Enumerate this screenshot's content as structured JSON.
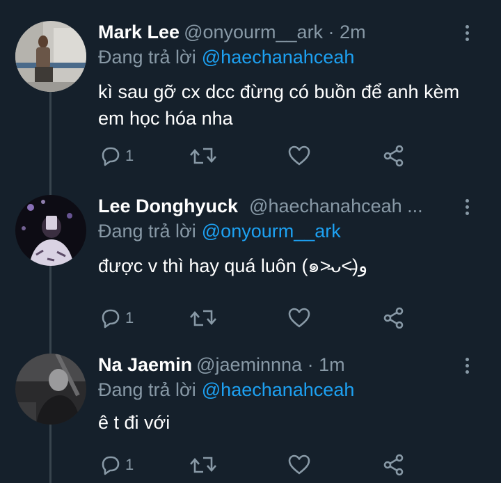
{
  "tweets": [
    {
      "name": "Mark Lee",
      "handle": "@onyourm__ark · 2m",
      "reply_prefix": "Đang trả lời",
      "reply_to": "@haechanahceah",
      "text": "kì sau gỡ cx dcc đừng có buồn để anh kèm em học hóa nha",
      "reply_count": "1"
    },
    {
      "name": "Lee Donghyuck",
      "handle": "@haechanahceah ...",
      "reply_prefix": "Đang trả lời",
      "reply_to": "@onyourm__ark",
      "text": "được v thì hay quá luôn (๑˃̵ᴗ˂̵)و",
      "reply_count": "1"
    },
    {
      "name": "Na Jaemin",
      "handle": "@jaeminnna · 1m",
      "reply_prefix": "Đang trả lời",
      "reply_to": "@haechanahceah",
      "text": "ê t đi với",
      "reply_count": "1"
    }
  ],
  "icons": {
    "reply": "comment-icon",
    "retweet": "retweet-icon",
    "like": "heart-icon",
    "share": "share-icon",
    "more": "more-vertical-icon"
  },
  "colors": {
    "background": "#15202b",
    "secondary_text": "#8899a6",
    "link": "#1da1f2",
    "thread_line": "#38444d"
  }
}
